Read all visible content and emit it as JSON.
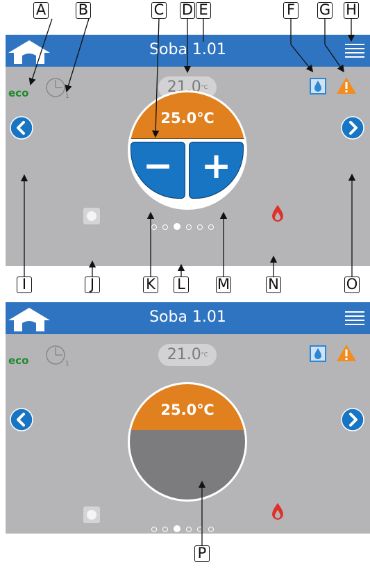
{
  "callouts": [
    "A",
    "B",
    "C",
    "D",
    "E",
    "F",
    "G",
    "H",
    "I",
    "J",
    "K",
    "L",
    "M",
    "N",
    "O",
    "P"
  ],
  "screens": [
    {
      "title": "Soba 1.01",
      "eco_label": "eco",
      "schedule_sub": "1",
      "current_temp": "21.0",
      "current_temp_unit": "°C",
      "setpoint": "25.0℃",
      "minus_label": "−",
      "plus_label": "+",
      "page_count": 6,
      "active_page": 3
    },
    {
      "title": "Soba 1.01",
      "eco_label": "eco",
      "schedule_sub": "1",
      "current_temp": "21.0",
      "current_temp_unit": "°C",
      "setpoint": "25.0℃",
      "page_count": 6,
      "active_page": 3
    }
  ],
  "colors": {
    "header": "#2f74c0",
    "screen_bg": "#b5b5b7",
    "dial_orange": "#e0801f",
    "button_blue": "#1775c4",
    "eco_green": "#1f8a2b",
    "flame_red": "#e0302a",
    "warning_orange": "#f28c1e",
    "drop_blue": "#2f86d1"
  },
  "icons": {
    "home": "home-icon",
    "menu": "menu-icon",
    "clock": "clock-icon",
    "drop": "water-drop-icon",
    "warning": "warning-icon",
    "nav_left": "chevron-left-icon",
    "nav_right": "chevron-right-icon",
    "flame": "flame-icon"
  }
}
